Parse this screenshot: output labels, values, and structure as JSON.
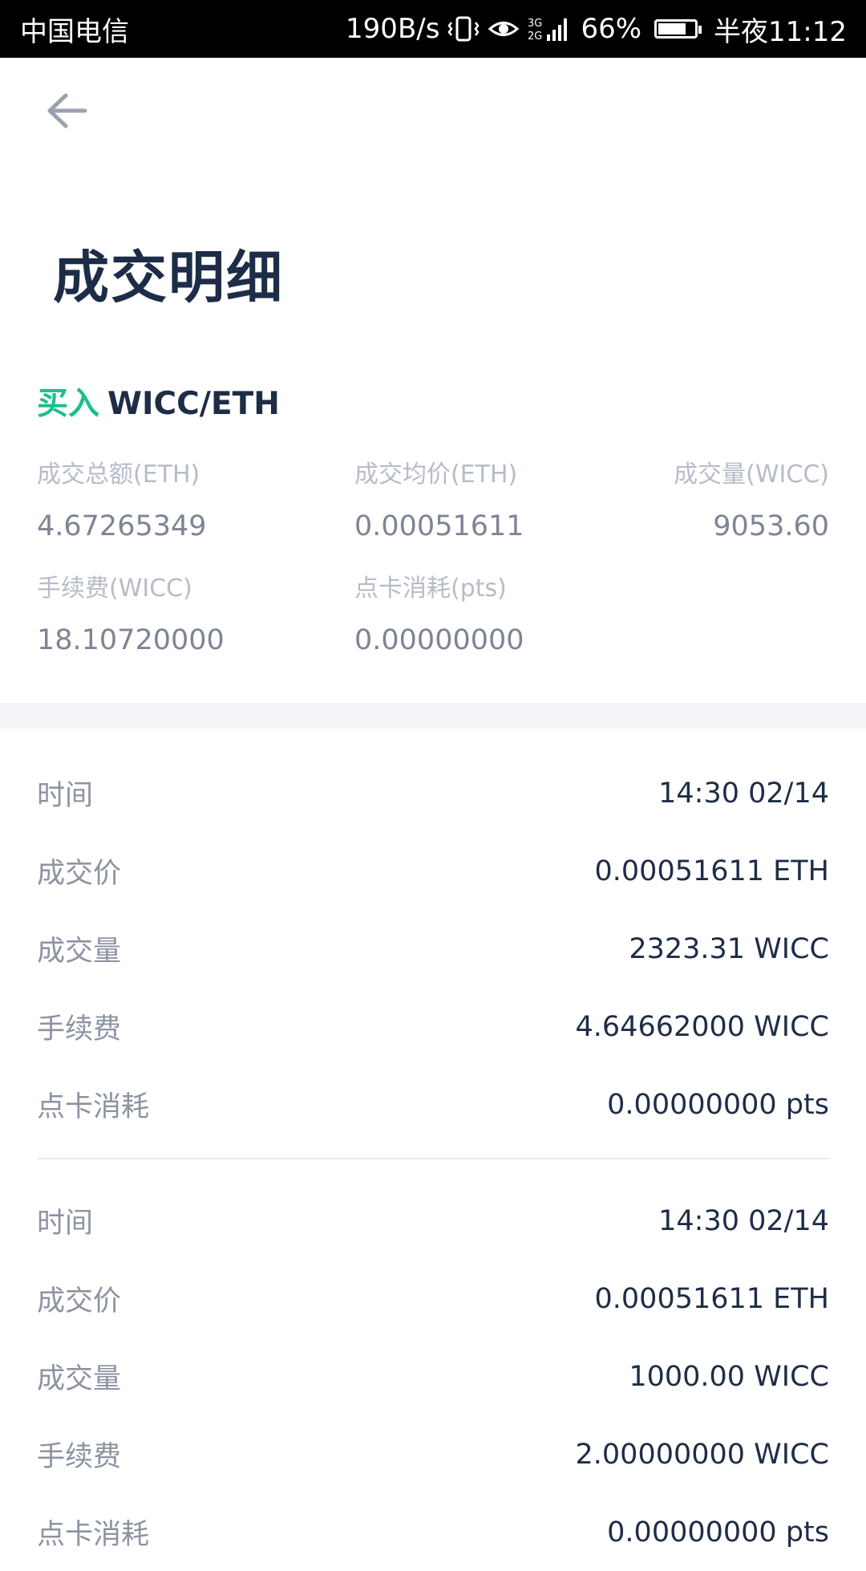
{
  "status_bar": {
    "carrier": "中国电信",
    "net_speed": "190B/s",
    "network": "3G 2G",
    "battery": "66%",
    "time": "半夜11:12"
  },
  "header": {
    "title": "成交明细"
  },
  "pair": {
    "side": "买入",
    "symbol": "WICC/ETH",
    "side_color": "#1bbf8c"
  },
  "summary": {
    "row1": [
      {
        "label": "成交总额(ETH)",
        "value": "4.67265349"
      },
      {
        "label": "成交均价(ETH)",
        "value": "0.00051611"
      },
      {
        "label": "成交量(WICC)",
        "value": "9053.60"
      }
    ],
    "row2": [
      {
        "label": "手续费(WICC)",
        "value": "18.10720000"
      },
      {
        "label": "点卡消耗(pts)",
        "value": "0.00000000"
      }
    ]
  },
  "records": [
    {
      "rows": [
        {
          "label": "时间",
          "value": "14:30 02/14"
        },
        {
          "label": "成交价",
          "value": "0.00051611 ETH"
        },
        {
          "label": "成交量",
          "value": "2323.31 WICC"
        },
        {
          "label": "手续费",
          "value": "4.64662000 WICC"
        },
        {
          "label": "点卡消耗",
          "value": "0.00000000 pts"
        }
      ]
    },
    {
      "rows": [
        {
          "label": "时间",
          "value": "14:30 02/14"
        },
        {
          "label": "成交价",
          "value": "0.00051611 ETH"
        },
        {
          "label": "成交量",
          "value": "1000.00 WICC"
        },
        {
          "label": "手续费",
          "value": "2.00000000 WICC"
        },
        {
          "label": "点卡消耗",
          "value": "0.00000000 pts"
        }
      ]
    }
  ]
}
